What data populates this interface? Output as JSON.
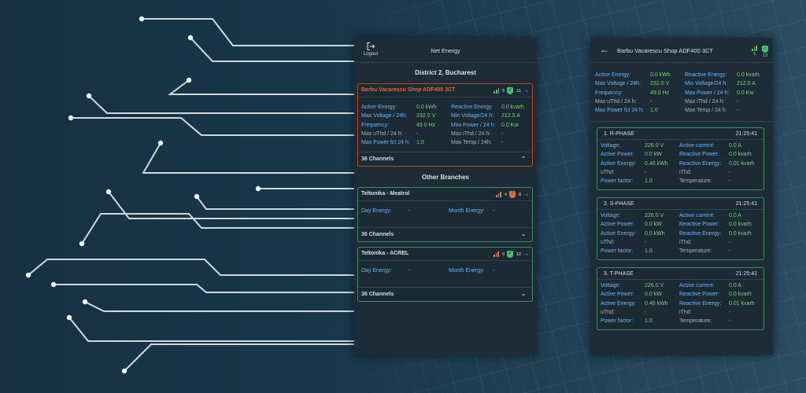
{
  "net_energy_screen": {
    "logout_label": "Logout",
    "title": "Net Energy",
    "district": "District 2, Bucharest",
    "main_device": {
      "name": "Barbu Vacarescu Shop ADF400 3CT",
      "signal": "5",
      "alerts": "11",
      "left_fields": [
        {
          "label": "Active Energy:",
          "value": "0.0 kWh"
        },
        {
          "label": "Max Voltage / 24h:",
          "value": "232.0 V"
        },
        {
          "label": "Frequency:",
          "value": "49.0 Hz"
        },
        {
          "label": "Max uThd / 24 h:",
          "value": "-"
        },
        {
          "label": "Max Power fct 24 h:",
          "value": "1.0"
        }
      ],
      "right_fields": [
        {
          "label": "Reactive Energy:",
          "value": "0.0 kvarh"
        },
        {
          "label": "Min Voltage/24 h:",
          "value": "212.0 A"
        },
        {
          "label": "Max Power / 24 h:",
          "value": "0.0 Kw"
        },
        {
          "label": "Max iThd / 24 h:",
          "value": "-"
        },
        {
          "label": "Max Temp / 24h:",
          "value": "-"
        }
      ],
      "channels": "36 Channels"
    },
    "other_branches_title": "Other Branches",
    "branches": [
      {
        "name": "Teltonika - Meatrol",
        "signal": "4",
        "alerts": "8",
        "day_energy_label": "Day Energy:",
        "day_energy": "-",
        "month_energy_label": "Month Energy:",
        "month_energy": "-",
        "channels": "36 Channels"
      },
      {
        "name": "Teltonika - ACREL",
        "signal": "0",
        "alerts": "12",
        "day_energy_label": "Day Energy:",
        "day_energy": "-",
        "month_energy_label": "Month Energy:",
        "month_energy": "-",
        "channels": "36 Channels"
      }
    ]
  },
  "device_screen": {
    "title": "Barbu Vacarescu Shop ADF400 3CT",
    "signal": "5",
    "alerts": "13",
    "left_fields": [
      {
        "label": "Active Energy:",
        "value": "0.0 kWh"
      },
      {
        "label": "Max Voltage / 24h:",
        "value": "232.0 V"
      },
      {
        "label": "Frequency:",
        "value": "49.0 Hz"
      },
      {
        "label": "Max uThd / 24 h:",
        "value": "-"
      },
      {
        "label": "Max Power fct 24 h:",
        "value": "1.0"
      }
    ],
    "right_fields": [
      {
        "label": "Reactive Energy:",
        "value": "0.0 kvarh"
      },
      {
        "label": "Min Voltage/24 h:",
        "value": "212.0 A"
      },
      {
        "label": "Max Power / 24 h:",
        "value": "0.0 Kw"
      },
      {
        "label": "Max iThd / 24 h:",
        "value": "-"
      },
      {
        "label": "Max Temp / 24 h:",
        "value": "-"
      }
    ],
    "phases": [
      {
        "title": "1.   R-PHASE",
        "time": "21:25:41",
        "left": [
          {
            "label": "Voltage:",
            "value": "226.0 V"
          },
          {
            "label": "Active Power:",
            "value": "0.0 kW"
          },
          {
            "label": "Active Energy:",
            "value": "0.46 kWh"
          },
          {
            "label": "uThd:",
            "value": "-"
          },
          {
            "label": "Power factor:",
            "value": "1.0"
          }
        ],
        "right": [
          {
            "label": "Active current:",
            "value": "0.0 A"
          },
          {
            "label": "Reactive Power:",
            "value": "0.0 kvarh"
          },
          {
            "label": "Reactive Energy:",
            "value": "0.01 kvarh"
          },
          {
            "label": "iThd:",
            "value": "-"
          },
          {
            "label": "Temperature:",
            "value": "-"
          }
        ]
      },
      {
        "title": "2.   S-PHASE",
        "time": "21:25:41",
        "left": [
          {
            "label": "Voltage:",
            "value": "226.0 V"
          },
          {
            "label": "Active Power:",
            "value": "0.0 kW"
          },
          {
            "label": "Active Energy:",
            "value": "0.0 kWh"
          },
          {
            "label": "uThd:",
            "value": "-"
          },
          {
            "label": "Power factor:",
            "value": "1.0"
          }
        ],
        "right": [
          {
            "label": "Active current:",
            "value": "0.0 A"
          },
          {
            "label": "Reactive Power:",
            "value": "0.0 kvarh"
          },
          {
            "label": "Reactive Energy:",
            "value": "0.0 kvarh"
          },
          {
            "label": "iThd:",
            "value": "-"
          },
          {
            "label": "Temperature:",
            "value": "-"
          }
        ]
      },
      {
        "title": "3.   T-PHASE",
        "time": "21:25:41",
        "left": [
          {
            "label": "Voltage:",
            "value": "226.0 V"
          },
          {
            "label": "Active Power:",
            "value": "0.0 kW"
          },
          {
            "label": "Active Energy:",
            "value": "0.46 kWh"
          },
          {
            "label": "uThd:",
            "value": "-"
          },
          {
            "label": "Power factor:",
            "value": "1.0"
          }
        ],
        "right": [
          {
            "label": "Active current:",
            "value": "0.0 A"
          },
          {
            "label": "Reactive Power:",
            "value": "0.0 kvarh"
          },
          {
            "label": "Reactive Energy:",
            "value": "0.01 kvarh"
          },
          {
            "label": "iThd:",
            "value": "-"
          },
          {
            "label": "Temperature:",
            "value": "-"
          }
        ]
      }
    ]
  },
  "colors": {
    "background": "#183447",
    "panel": "#1d2c36",
    "accent_blue": "#6db7ff",
    "value_green": "#7cd27a",
    "warning_orange": "#e0683a",
    "card_border_ok": "#3e8a6a"
  },
  "icons": [
    "logout-icon",
    "signal-bars-icon",
    "shield-check-icon",
    "arrow-right-icon",
    "chevron-up-icon",
    "chevron-down-icon",
    "back-arrow-icon"
  ]
}
